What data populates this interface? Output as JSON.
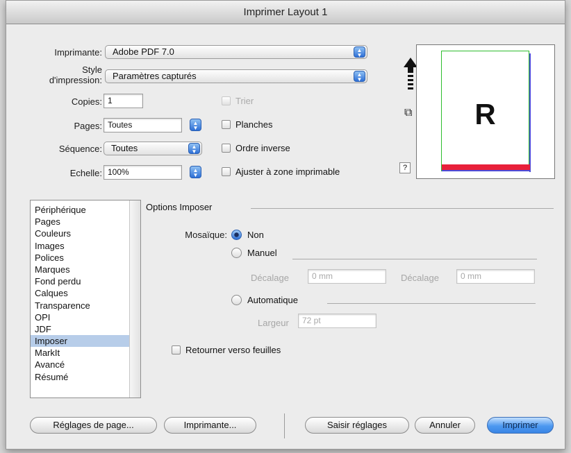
{
  "window": {
    "title": "Imprimer Layout 1"
  },
  "form": {
    "imprimante_label": "Imprimante:",
    "imprimante_value": "Adobe PDF 7.0",
    "style_label_line1": "Style",
    "style_label_line2": "d'impression:",
    "style_value": "Paramètres capturés",
    "copies_label": "Copies:",
    "copies_value": "1",
    "pages_label": "Pages:",
    "pages_value": "Toutes",
    "sequence_label": "Séquence:",
    "sequence_value": "Toutes",
    "echelle_label": "Echelle:",
    "echelle_value": "100%"
  },
  "checkboxes": {
    "trier": "Trier",
    "planches": "Planches",
    "ordre_inverse": "Ordre inverse",
    "ajuster": "Ajuster à zone imprimable"
  },
  "preview": {
    "letter": "R",
    "help": "?"
  },
  "sidebar": {
    "items": [
      "Périphérique",
      "Pages",
      "Couleurs",
      "Images",
      "Polices",
      "Marques",
      "Fond perdu",
      "Calques",
      "Transparence",
      "OPI",
      "JDF",
      "Imposer",
      "MarkIt",
      "Avancé",
      "Résumé"
    ],
    "selected": "Imposer"
  },
  "panel": {
    "title": "Options Imposer",
    "mosaique_label": "Mosaïque:",
    "radio_non": "Non",
    "radio_manuel": "Manuel",
    "decalage1_label": "Décalage",
    "decalage1_value": "0 mm",
    "decalage2_label": "Décalage",
    "decalage2_value": "0 mm",
    "radio_auto": "Automatique",
    "largeur_label": "Largeur",
    "largeur_value": "72 pt",
    "retourner": "Retourner verso feuilles"
  },
  "buttons": {
    "reglages_page": "Réglages de page...",
    "imprimante": "Imprimante...",
    "saisir": "Saisir réglages",
    "annuler": "Annuler",
    "imprimer": "Imprimer"
  }
}
